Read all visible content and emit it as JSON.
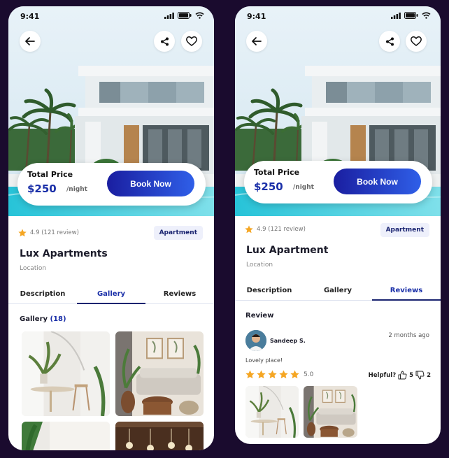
{
  "left": {
    "status": {
      "time": "9:41"
    },
    "price": {
      "label": "Total Price",
      "value": "$250",
      "unit": "/night"
    },
    "book_label": "Book Now",
    "rating": "4.9 (121 review)",
    "badge": "Apartment",
    "title": "Lux Apartments",
    "location": "Location",
    "tabs": [
      {
        "label": "Description",
        "active": false
      },
      {
        "label": "Gallery",
        "active": true
      },
      {
        "label": "Reviews",
        "active": false
      }
    ],
    "gallery": {
      "label": "Gallery",
      "count": "(18)"
    }
  },
  "right": {
    "status": {
      "time": "9:41"
    },
    "price": {
      "label": "Total Price",
      "value": "$250",
      "unit": "/night"
    },
    "book_label": "Book Now",
    "rating": "4.9 (121 review)",
    "badge": "Apartment",
    "title": "Lux Apartment",
    "location": "Location",
    "tabs": [
      {
        "label": "Description",
        "active": false
      },
      {
        "label": "Gallery",
        "active": false
      },
      {
        "label": "Reviews",
        "active": true
      }
    ],
    "review": {
      "heading": "Review",
      "reviewer": "Sandeep S.",
      "time_ago": "2 months ago",
      "comment": "Lovely place!",
      "stars": 5,
      "score": "5.0",
      "helpful_label": "Helpful?",
      "likes": "5",
      "dislikes": "2"
    }
  },
  "colors": {
    "brand": "#1a2fa8",
    "star": "#f5a623",
    "background": "#1a0b2e"
  },
  "icons": [
    "back-arrow-icon",
    "share-icon",
    "heart-icon",
    "star-icon",
    "thumbs-up-icon",
    "thumbs-down-icon",
    "signal-icon",
    "wifi-icon",
    "battery-icon"
  ]
}
